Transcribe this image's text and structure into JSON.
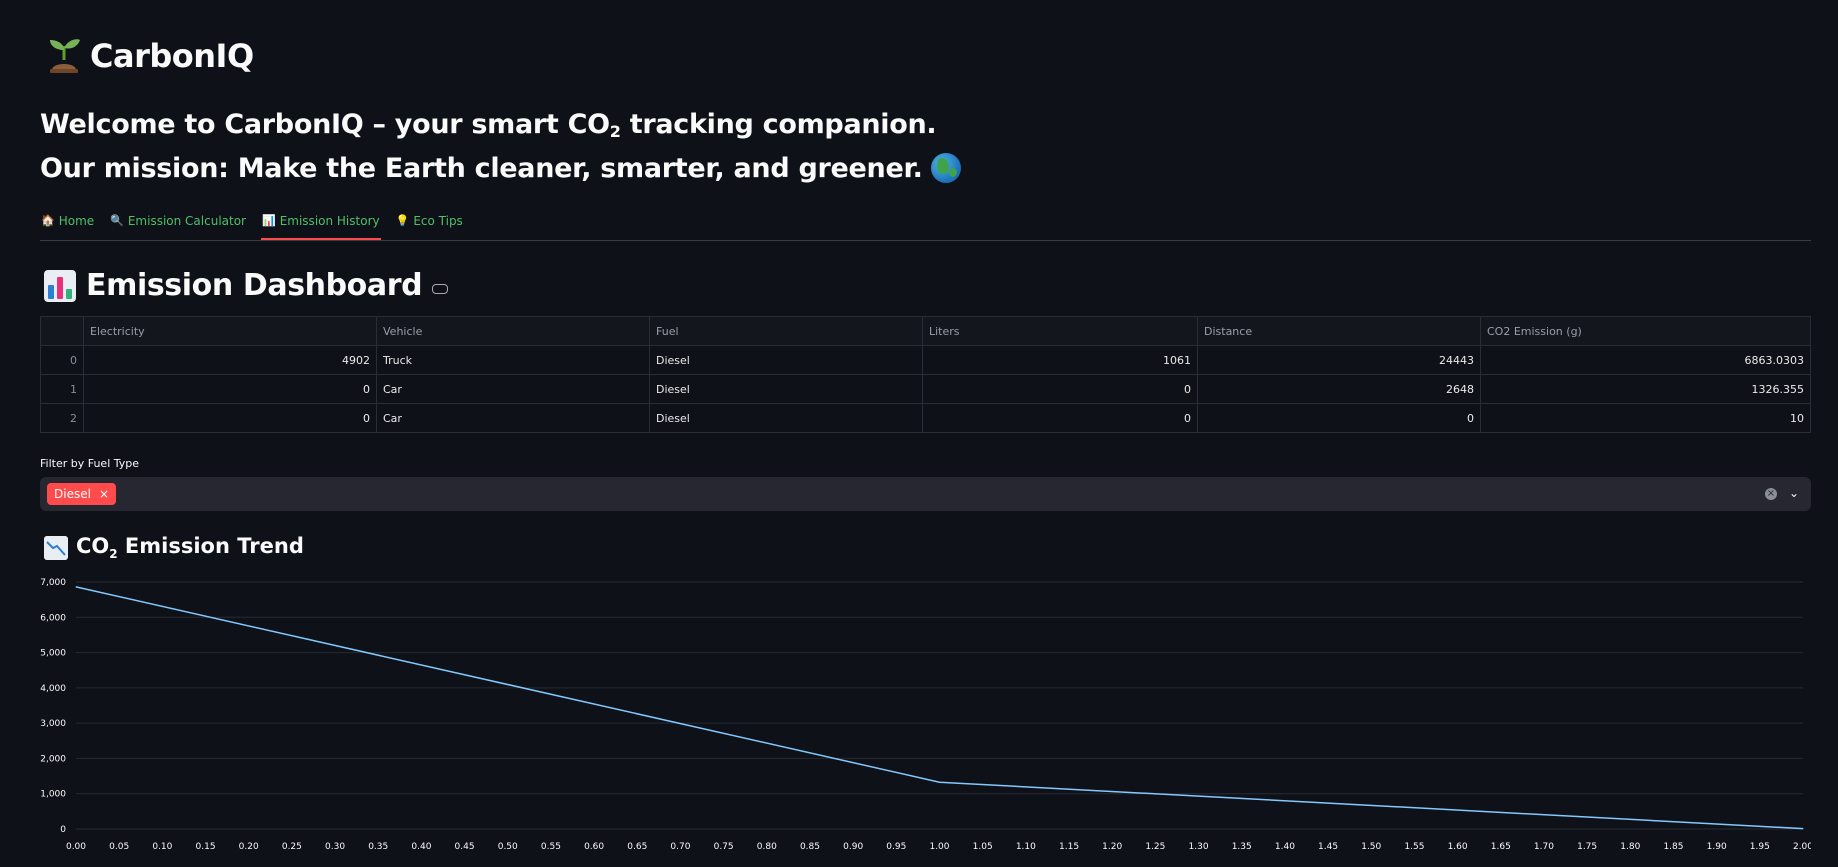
{
  "app": {
    "name": "CarbonIQ"
  },
  "welcome": {
    "line1_pre": "Welcome to CarbonIQ – your smart CO",
    "line1_sub": "2",
    "line1_post": " tracking companion.",
    "line2": "Our mission: Make the Earth cleaner, smarter, and greener."
  },
  "tabs": [
    {
      "icon": "🏠",
      "label": "Home",
      "active": false
    },
    {
      "icon": "🔍",
      "label": "Emission Calculator",
      "active": false
    },
    {
      "icon": "📊",
      "label": "Emission History",
      "active": true
    },
    {
      "icon": "💡",
      "label": "Eco Tips",
      "active": false
    }
  ],
  "dashboard": {
    "title": "Emission Dashboard"
  },
  "table": {
    "columns": [
      "",
      "Electricity",
      "Vehicle",
      "Fuel",
      "Liters",
      "Distance",
      "CO2 Emission (g)"
    ],
    "rows": [
      [
        "0",
        "4902",
        "Truck",
        "Diesel",
        "1061",
        "24443",
        "6863.0303"
      ],
      [
        "1",
        "0",
        "Car",
        "Diesel",
        "0",
        "2648",
        "1326.355"
      ],
      [
        "2",
        "0",
        "Car",
        "Diesel",
        "0",
        "0",
        "10"
      ]
    ]
  },
  "filter": {
    "label": "Filter by Fuel Type",
    "selected": [
      "Diesel"
    ],
    "remove_glyph": "×",
    "clear_glyph": "×",
    "chevron_glyph": "⌄"
  },
  "trend": {
    "title_pre": "CO",
    "title_sub": "2",
    "title_post": " Emission Trend"
  },
  "colors": {
    "accent": "#ff4b4b",
    "tab_text": "#4fbf6a",
    "line": "#83c9ff",
    "background": "#0e1117"
  },
  "chart_data": {
    "type": "line",
    "x": [
      0,
      1,
      2
    ],
    "series": [
      {
        "values": [
          6863.0303,
          1326.355,
          10
        ]
      }
    ],
    "xlim": [
      0,
      2
    ],
    "ylim": [
      0,
      7000
    ],
    "xticks": [
      "0.00",
      "0.05",
      "0.10",
      "0.15",
      "0.20",
      "0.25",
      "0.30",
      "0.35",
      "0.40",
      "0.45",
      "0.50",
      "0.55",
      "0.60",
      "0.65",
      "0.70",
      "0.75",
      "0.80",
      "0.85",
      "0.90",
      "0.95",
      "1.00",
      "1.05",
      "1.10",
      "1.15",
      "1.20",
      "1.25",
      "1.30",
      "1.35",
      "1.40",
      "1.45",
      "1.50",
      "1.55",
      "1.60",
      "1.65",
      "1.70",
      "1.75",
      "1.80",
      "1.85",
      "1.90",
      "1.95",
      "2.00"
    ],
    "yticks": [
      "0",
      "1,000",
      "2,000",
      "3,000",
      "4,000",
      "5,000",
      "6,000",
      "7,000"
    ],
    "grid": true
  }
}
